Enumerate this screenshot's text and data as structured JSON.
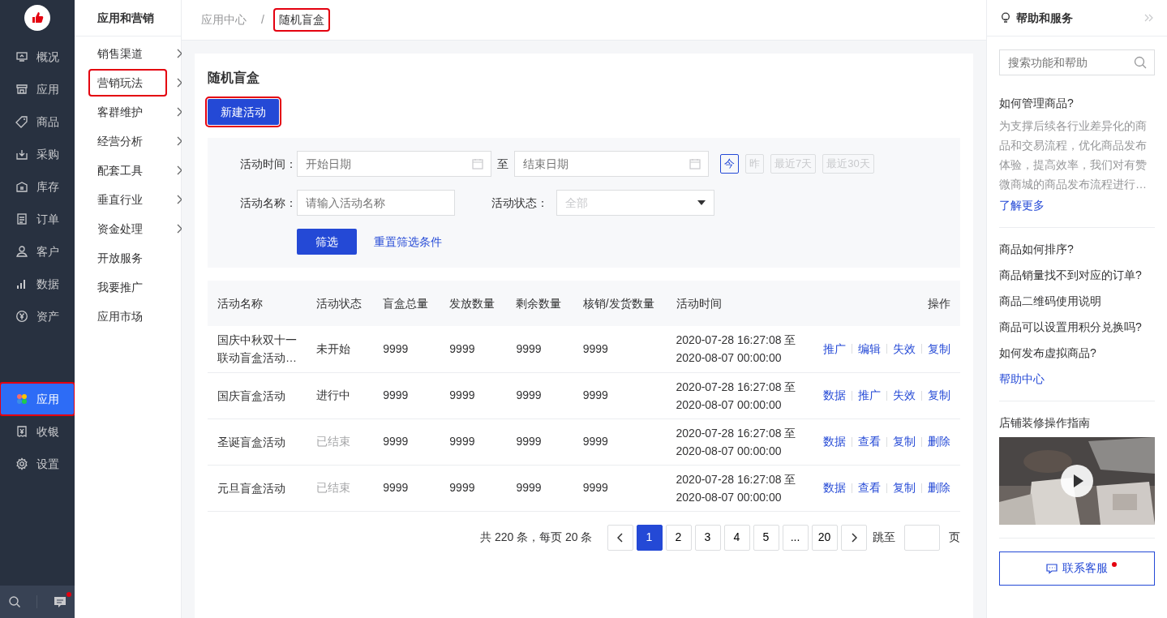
{
  "sidebar": {
    "items": [
      {
        "label": "概况",
        "selected": false,
        "highlighted": false
      },
      {
        "label": "应用",
        "selected": false,
        "highlighted": false
      },
      {
        "label": "商品",
        "selected": false,
        "highlighted": false
      },
      {
        "label": "采购",
        "selected": false,
        "highlighted": false
      },
      {
        "label": "库存",
        "selected": false,
        "highlighted": false
      },
      {
        "label": "订单",
        "selected": false,
        "highlighted": false
      },
      {
        "label": "客户",
        "selected": false,
        "highlighted": false
      },
      {
        "label": "数据",
        "selected": false,
        "highlighted": false
      },
      {
        "label": "资产",
        "selected": false,
        "highlighted": false
      }
    ],
    "bottom_items": [
      {
        "label": "应用",
        "selected": true,
        "highlighted": true
      },
      {
        "label": "收银",
        "selected": false,
        "highlighted": false
      },
      {
        "label": "设置",
        "selected": false,
        "highlighted": false
      }
    ],
    "message_unread": true
  },
  "subnav": {
    "title": "应用和营销",
    "items": [
      {
        "label": "销售渠道",
        "has_children": true,
        "highlighted": false
      },
      {
        "label": "营销玩法",
        "has_children": true,
        "highlighted": true
      },
      {
        "label": "客群维护",
        "has_children": true,
        "highlighted": false
      },
      {
        "label": "经营分析",
        "has_children": true,
        "highlighted": false
      },
      {
        "label": "配套工具",
        "has_children": true,
        "highlighted": false
      },
      {
        "label": "垂直行业",
        "has_children": true,
        "highlighted": false
      },
      {
        "label": "资金处理",
        "has_children": true,
        "highlighted": false
      },
      {
        "label": "开放服务",
        "has_children": false,
        "highlighted": false
      },
      {
        "label": "我要推广",
        "has_children": false,
        "highlighted": false
      },
      {
        "label": "应用市场",
        "has_children": false,
        "highlighted": false
      }
    ]
  },
  "breadcrumb": [
    {
      "label": "应用中心",
      "highlighted": false
    },
    {
      "label": "随机盲盒",
      "highlighted": true
    }
  ],
  "breadcrumb_separator": "/",
  "page": {
    "title": "随机盲盒",
    "new_button": {
      "label": "新建活动",
      "highlighted": true
    }
  },
  "filters": {
    "time_label": "活动时间：",
    "start_placeholder": "开始日期",
    "to_label": "至",
    "end_placeholder": "结束日期",
    "presets": [
      {
        "label": "今",
        "selected": true
      },
      {
        "label": "昨",
        "selected": false
      },
      {
        "label": "最近7天",
        "selected": false
      },
      {
        "label": "最近30天",
        "selected": false
      }
    ],
    "name_label": "活动名称：",
    "name_placeholder": "请输入活动名称",
    "status_label": "活动状态：",
    "status_placeholder": "全部",
    "filter_button": "筛选",
    "reset_link": "重置筛选条件"
  },
  "table": {
    "columns": [
      "活动名称",
      "活动状态",
      "盲盒总量",
      "发放数量",
      "剩余数量",
      "核销/发货数量",
      "活动时间",
      "操作"
    ],
    "rows": [
      {
        "name": "国庆中秋双十一联动盲盒活动…",
        "status": "未开始",
        "ended": false,
        "total": "9999",
        "issued": "9999",
        "remaining": "9999",
        "redeemed": "9999",
        "time_start": "2020-07-28 16:27:08 至",
        "time_end": "2020-08-07 00:00:00",
        "actions": [
          "推广",
          "编辑",
          "失效",
          "复制"
        ]
      },
      {
        "name": "国庆盲盒活动",
        "status": "进行中",
        "ended": false,
        "total": "9999",
        "issued": "9999",
        "remaining": "9999",
        "redeemed": "9999",
        "time_start": "2020-07-28 16:27:08 至",
        "time_end": "2020-08-07 00:00:00",
        "actions": [
          "数据",
          "推广",
          "失效",
          "复制"
        ]
      },
      {
        "name": "圣诞盲盒活动",
        "status": "已结束",
        "ended": true,
        "total": "9999",
        "issued": "9999",
        "remaining": "9999",
        "redeemed": "9999",
        "time_start": "2020-07-28 16:27:08 至",
        "time_end": "2020-08-07 00:00:00",
        "actions": [
          "数据",
          "查看",
          "复制",
          "删除"
        ]
      },
      {
        "name": "元旦盲盒活动",
        "status": "已结束",
        "ended": true,
        "total": "9999",
        "issued": "9999",
        "remaining": "9999",
        "redeemed": "9999",
        "time_start": "2020-07-28 16:27:08 至",
        "time_end": "2020-08-07 00:00:00",
        "actions": [
          "数据",
          "查看",
          "复制",
          "删除"
        ]
      }
    ]
  },
  "pagination": {
    "summary": "共 220 条，每页 20 条",
    "pages": [
      {
        "label": "1",
        "selected": true
      },
      {
        "label": "2",
        "selected": false
      },
      {
        "label": "3",
        "selected": false
      },
      {
        "label": "4",
        "selected": false
      },
      {
        "label": "5",
        "selected": false
      },
      {
        "label": "...",
        "selected": false
      },
      {
        "label": "20",
        "selected": false
      }
    ],
    "jump_label": "跳至",
    "page_unit": "页"
  },
  "help_panel": {
    "title": "帮助和服务",
    "search_placeholder": "搜索功能和帮助",
    "article_title": "如何管理商品?",
    "article_text": "为支撑后续各行业差异化的商品和交易流程，优化商品发布体验，提高效率，我们对有赞微商城的商品发布流程进行…",
    "more_link": "了解更多",
    "questions": [
      "商品如何排序?",
      "商品销量找不到对应的订单?",
      "商品二维码使用说明",
      "商品可以设置用积分兑换吗?",
      "如何发布虚拟商品?"
    ],
    "center_link": "帮助中心",
    "video_title": "店铺装修操作指南",
    "contact_button": "联系客服",
    "contact_unread": true
  }
}
